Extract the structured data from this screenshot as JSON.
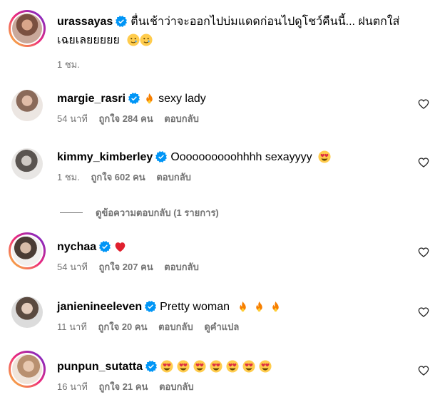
{
  "post": {
    "username": "urassayas",
    "caption_line1": "ตื่นเช้าว่าจะออกไปบ่มแดดก่อนไปดูโชว์คืนนี้... ฝนตกใส่",
    "caption_line2": "เฉยเลยยยยย",
    "caption_emojis": [
      "smiling-face-with-tear",
      "smiling-face-with-tear"
    ],
    "time": "1 ชม."
  },
  "comments": [
    {
      "username": "margie_rasri",
      "verified": true,
      "emojis_before": [
        "fire"
      ],
      "text": "sexy lady",
      "time": "54 นาที",
      "likes": "ถูกใจ 284 คน",
      "reply": "ตอบกลับ",
      "translate": ""
    },
    {
      "username": "kimmy_kimberley",
      "verified": true,
      "text": "Oooooooooohhhh sexayyyy",
      "emojis_after": [
        "smiling-face-with-heart-eyes"
      ],
      "time": "1 ชม.",
      "likes": "ถูกใจ 602 คน",
      "reply": "ตอบกลับ",
      "translate": ""
    },
    {
      "username": "nychaa",
      "verified": true,
      "text": "",
      "emojis_after": [
        "red-heart"
      ],
      "time": "54 นาที",
      "likes": "ถูกใจ 207 คน",
      "reply": "ตอบกลับ",
      "translate": ""
    },
    {
      "username": "janienineeleven",
      "verified": true,
      "text": "Pretty woman",
      "emojis_after": [
        "fire",
        "fire",
        "fire"
      ],
      "time": "11 นาที",
      "likes": "ถูกใจ 20 คน",
      "reply": "ตอบกลับ",
      "translate": "ดูคำแปล"
    },
    {
      "username": "punpun_sutatta",
      "verified": true,
      "text": "",
      "emojis_after": [
        "smiling-face-with-heart-eyes",
        "smiling-face-with-heart-eyes",
        "smiling-face-with-heart-eyes",
        "smiling-face-with-heart-eyes",
        "smiling-face-with-heart-eyes",
        "smiling-face-with-heart-eyes",
        "smiling-face-with-heart-eyes"
      ],
      "time": "16 นาที",
      "likes": "ถูกใจ 21 คน",
      "reply": "ตอบกลับ",
      "translate": ""
    }
  ],
  "view_replies": "ดูข้อความตอบกลับ (1 รายการ)",
  "colors": {
    "verified": "#0095f6",
    "meta": "#737373",
    "heart": "#ed4956",
    "fire": "#f77f00"
  }
}
